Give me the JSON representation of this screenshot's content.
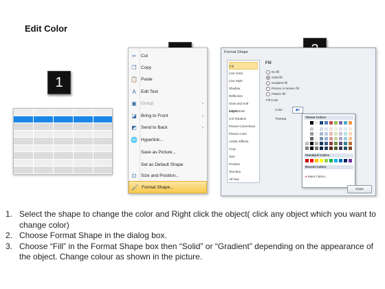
{
  "title": "Edit Color",
  "steps": {
    "one": "1",
    "two": "2",
    "three": "3"
  },
  "context_menu": {
    "items": [
      {
        "label": "Cut",
        "icon": "scissors-icon",
        "arrow": ""
      },
      {
        "label": "Copy",
        "icon": "copy-icon",
        "arrow": ""
      },
      {
        "label": "Paste",
        "icon": "paste-icon",
        "arrow": ""
      },
      {
        "label": "Edit Text",
        "icon": "edit-text-icon",
        "arrow": ""
      },
      {
        "label": "Group",
        "icon": "group-icon",
        "arrow": "›"
      },
      {
        "label": "Bring to Front",
        "icon": "bring-to-front-icon",
        "arrow": "›"
      },
      {
        "label": "Send to Back",
        "icon": "send-to-back-icon",
        "arrow": "›"
      },
      {
        "label": "Hyperlink...",
        "icon": "hyperlink-icon",
        "arrow": ""
      },
      {
        "label": "Save as Picture...",
        "icon": "",
        "arrow": ""
      },
      {
        "label": "Set as Default Shape",
        "icon": "",
        "arrow": ""
      },
      {
        "label": "Size and Position...",
        "icon": "size-position-icon",
        "arrow": ""
      },
      {
        "label": "Format Shape...",
        "icon": "format-shape-icon",
        "arrow": ""
      }
    ]
  },
  "dialog": {
    "title": "Format Shape",
    "categories": [
      "Fill",
      "Line Color",
      "Line Style",
      "Shadow",
      "Reflection",
      "Glow and Soft Edges",
      "3-D Format",
      "3-D Rotation",
      "Picture Corrections",
      "Picture Color",
      "Artistic Effects",
      "Crop",
      "Size",
      "Position",
      "Text Box",
      "Alt Text"
    ],
    "section_title": "Fill",
    "options": [
      "No fill",
      "Solid fill",
      "Gradient fill",
      "Picture or texture fill",
      "Pattern fill"
    ],
    "fill_color_label": "Fill Color",
    "color_label": "Color:",
    "transparency_label": "Transpa",
    "theme_colors_label": "Theme Colors",
    "standard_colors_label": "Standard Colors",
    "recent_colors_label": "Recent Colors",
    "more_colors_label": "More Colors...",
    "close_label": "Close"
  },
  "instructions": [
    {
      "n": "1.",
      "text": "Select the shape to change the color and Right click the object( click any object which you want to change color)"
    },
    {
      "n": "2.",
      "text": "Choose Format Shape in the dialog box."
    },
    {
      "n": "3.",
      "text": "Choose “Fill” in the Format Shape box then “Solid” or “Gradient” depending on the appearance of the object. Change colour as shown in the picture."
    }
  ],
  "colors": {
    "table_header": "#1a86e8",
    "selection": "#f8c94c",
    "theme": [
      "#ffffff",
      "#000000",
      "#eeece1",
      "#1f497d",
      "#4f81bd",
      "#c0504d",
      "#9bbb59",
      "#8064a2",
      "#4bacc6",
      "#f79646"
    ],
    "standard": [
      "#c00000",
      "#ff0000",
      "#ffc000",
      "#ffff00",
      "#92d050",
      "#00b050",
      "#00b0f0",
      "#0070c0",
      "#002060",
      "#7030a0"
    ]
  }
}
